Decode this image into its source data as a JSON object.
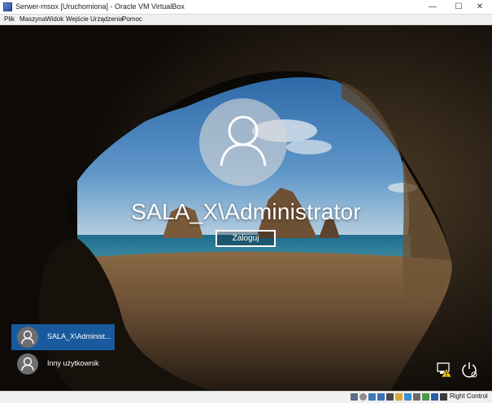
{
  "window": {
    "title": "Serwer-msox [Uruchomiona] - Oracle VM VirtualBox",
    "minimize_glyph": "—",
    "maximize_glyph": "☐",
    "close_glyph": "✕"
  },
  "menu": {
    "items": [
      "Plik",
      "Maszyna",
      "Widok",
      "Wejście",
      "Urządzenia",
      "Pomoc"
    ]
  },
  "login": {
    "username": "SALA_X\\Administrator",
    "signin_label": "Zaloguj"
  },
  "user_list": [
    {
      "label": "SALA_X\\Administ...",
      "selected": true,
      "icon": "user-icon"
    },
    {
      "label": "Inny użytkownik",
      "selected": false,
      "icon": "user-icon"
    }
  ],
  "system_icons": {
    "network": "network-warning-icon",
    "accessibility": "ease-of-access-icon",
    "power": "power-icon"
  },
  "statusbar": {
    "host_key_label": "Right Control",
    "icons": [
      "hard-disk-icon",
      "optical-drive-icon",
      "audio-icon",
      "network-icon",
      "usb-icon",
      "shared-folders-icon",
      "display-icon",
      "video-capture-icon",
      "cpu-icon",
      "mouse-integration-icon",
      "keyboard-icon"
    ]
  },
  "colors": {
    "selected_tile": "#185a9d",
    "sky": "#3a78b5",
    "sea": "#1b6f93",
    "sand": "#b58a5a"
  }
}
